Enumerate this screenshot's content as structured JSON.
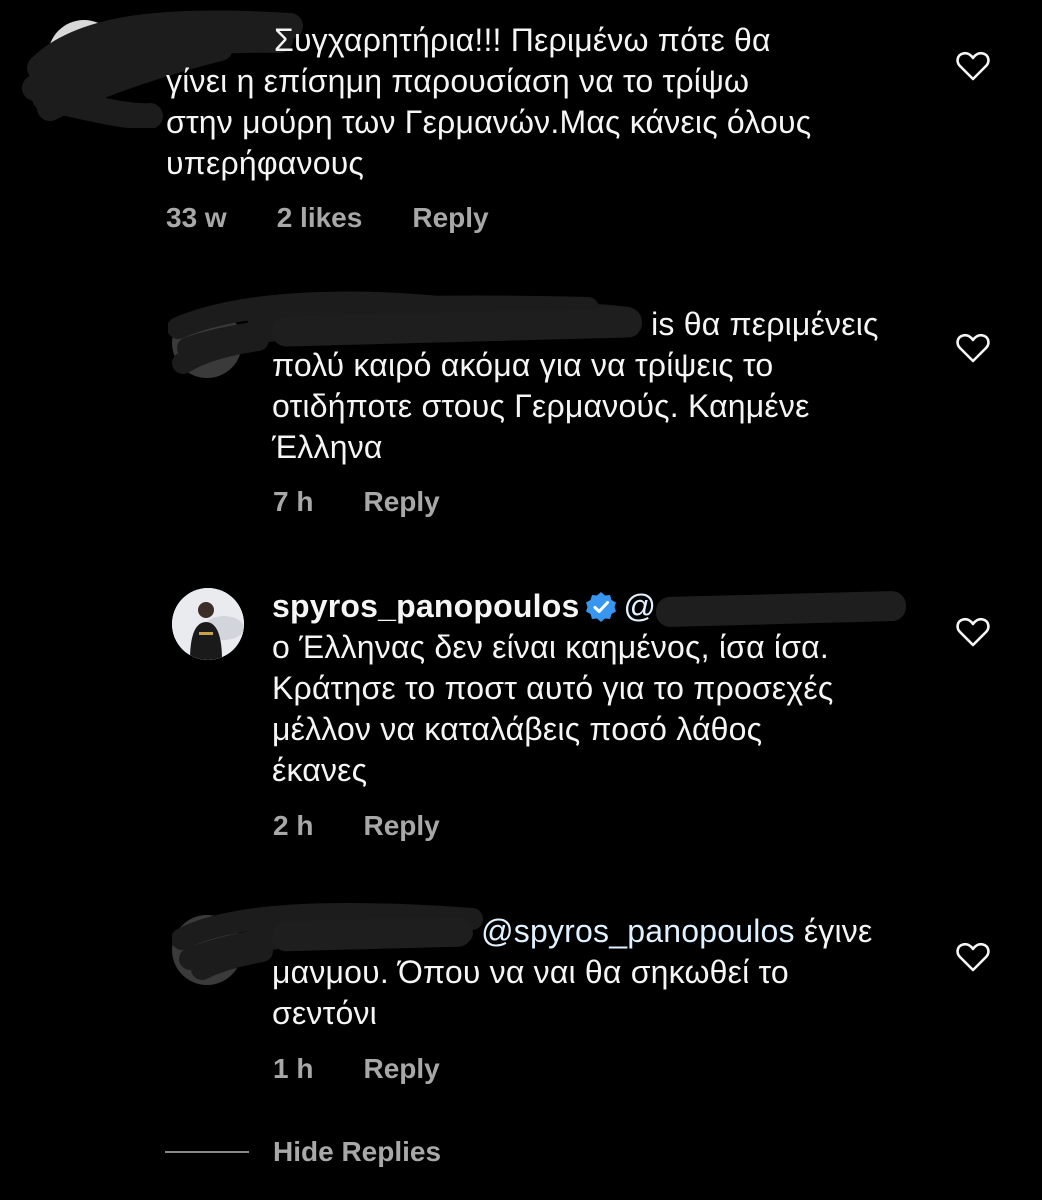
{
  "comments": [
    {
      "text": "Συγχαρητήρια!!! Περιμένω πότε θα γίνει η επίσημη παρουσίαση να το τρίψω στην μούρη των Γερμανών.Μας κάνεις όλους υπερήφανους",
      "line1": "Συγχαρητήρια!!! Περιμένω πότε θα",
      "line2": "γίνει η επίσημη παρουσίαση να το τρίψω",
      "line3": "στην μούρη των Γερμανών.Μας κάνεις όλους",
      "line4": "υπερήφανους",
      "time": "33 w",
      "likes": "2 likes",
      "reply": "Reply"
    },
    {
      "line1_tail": "is θα περιμένεις",
      "line2": "πολύ καιρό ακόμα για να τρίψεις το",
      "line3": "οτιδήποτε στους Γερμανούς. Καημένε",
      "line4": "Έλληνα",
      "time": "7 h",
      "reply": "Reply"
    },
    {
      "username": "spyros_panopoulos",
      "line1_tail": "@",
      "line2": "ο Έλληνας δεν είναι καημένος, ίσα ίσα.",
      "line3": "Κράτησε το ποστ αυτό για το προσεχές",
      "line4": "μέλλον να καταλάβεις ποσό λάθος",
      "line5": "έκανες",
      "time": "2 h",
      "reply": "Reply"
    },
    {
      "mention": "@spyros_panopoulos",
      "line1_tail": "έγινε",
      "line2": "μανμου. Όπου να ναι θα σηκωθεί το",
      "line3": "σεντόνι",
      "time": "1 h",
      "reply": "Reply"
    }
  ],
  "hide_replies_label": "Hide Replies",
  "colors": {
    "background": "#000000",
    "text": "#f5f5f5",
    "meta": "#a8a8a8",
    "verified": "#3797f0"
  },
  "icons": {
    "like": "heart-outline-icon",
    "verified": "verified-badge-icon"
  }
}
